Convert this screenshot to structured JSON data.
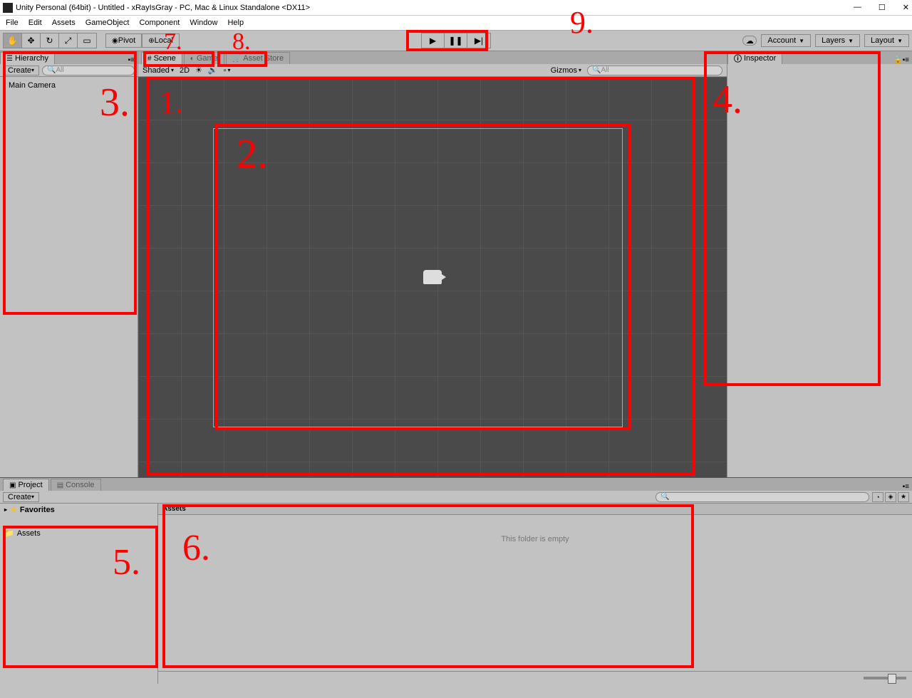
{
  "window": {
    "title": "Unity Personal (64bit) - Untitled - xRayIsGray - PC, Mac & Linux Standalone <DX11>"
  },
  "menu": {
    "file": "File",
    "edit": "Edit",
    "assets": "Assets",
    "gameObject": "GameObject",
    "component": "Component",
    "window": "Window",
    "help": "Help"
  },
  "toolbar": {
    "pivot": "Pivot",
    "local": "Local",
    "account": "Account",
    "layers": "Layers",
    "layout": "Layout"
  },
  "hierarchy": {
    "tab": "Hierarchy",
    "create": "Create",
    "searchPlaceholder": "All",
    "items": [
      "Main Camera"
    ]
  },
  "scene": {
    "tabScene": "Scene",
    "tabGame": "Game",
    "tabAssetStore": "Asset Store",
    "shaded": "Shaded",
    "twoD": "2D",
    "gizmos": "Gizmos",
    "searchPlaceholder": "All"
  },
  "inspector": {
    "tab": "Inspector"
  },
  "project": {
    "tabProject": "Project",
    "tabConsole": "Console",
    "create": "Create",
    "favorites": "Favorites",
    "assets": "Assets",
    "breadcrumb": "Assets",
    "empty": "This folder is empty"
  },
  "annotations": {
    "a1": "1.",
    "a2": "2.",
    "a3": "3.",
    "a4": "4.",
    "a5": "5.",
    "a6": "6.",
    "a7": "7.",
    "a8": "8.",
    "a9": "9."
  }
}
